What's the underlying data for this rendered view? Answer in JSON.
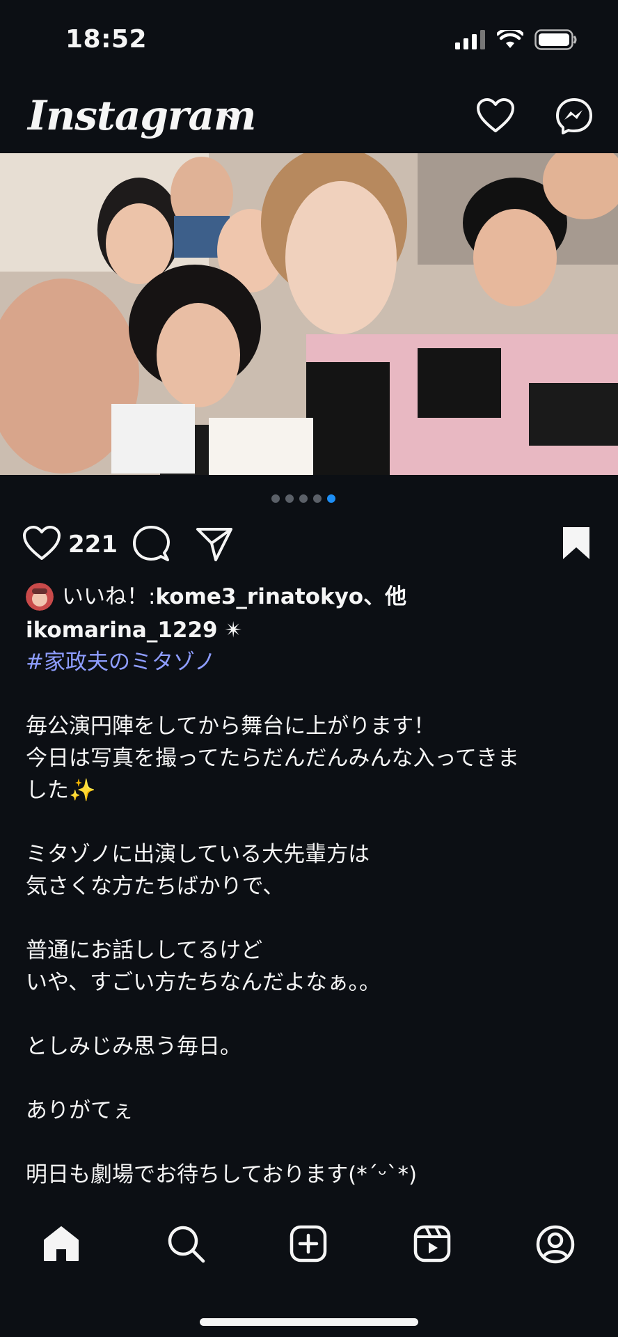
{
  "status_bar": {
    "time": "18:52"
  },
  "header": {
    "logo": "Instagram"
  },
  "post": {
    "carousel": {
      "total": 5,
      "active": 5
    },
    "likes": "221",
    "liked_by_prefix": "いいね！: ",
    "liked_by_user": "kome3_rinatokyo",
    "liked_by_suffix": "、他",
    "author": "ikomarina_1229",
    "author_suffix": " ✴",
    "hashtag": "#家政夫のミタゾノ",
    "caption": [
      "毎公演円陣をしてから舞台に上がります！",
      "今日は写真を撮ってたらだんだんみんな入ってきま",
      "した✨",
      "",
      "ミタゾノに出演している大先輩方は",
      "気さくな方たちばかりで、",
      "",
      "普通にお話ししてるけど",
      "いや、すごい方たちなんだよなぁ。。",
      "",
      "としみじみ思う毎日。",
      "",
      "ありがてぇ",
      "",
      "明日も劇場でお待ちしております(*´ᵕ`*)"
    ]
  },
  "tab_bar": {
    "items": [
      "home-icon",
      "search-icon",
      "create-icon",
      "reels-icon",
      "profile-icon"
    ]
  },
  "colors": {
    "background": "#0c0f14",
    "hashtag": "#8e9dff",
    "active_dot": "#1d8ef5"
  }
}
